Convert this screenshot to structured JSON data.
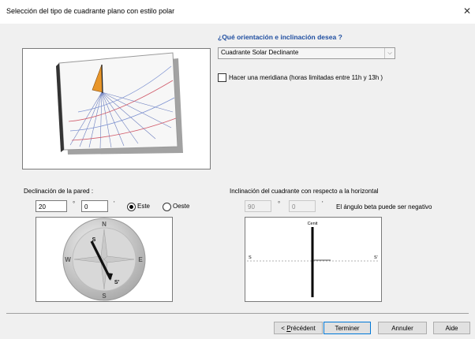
{
  "window": {
    "title": "Selección del tipo de cuadrante plano con estilo polar",
    "close_glyph": "✕"
  },
  "orientation": {
    "question": "¿Qué orientación e inclinación desea ?",
    "selected_option": "Cuadrante Solar Declinante",
    "meridian_label": "Hacer una meridiana (horas limitadas entre 11h y 13h )",
    "meridian_checked": false
  },
  "declination": {
    "label": "Declinación de la pared :",
    "degrees": "20",
    "minutes": "0",
    "deg_symbol": "°",
    "min_symbol": "'",
    "east_label": "Este",
    "west_label": "Oeste",
    "selected": "east",
    "compass": {
      "north": "N",
      "south": "S",
      "east": "E",
      "west": "W",
      "needle_s": "S",
      "needle_s_prime": "S'"
    }
  },
  "inclination": {
    "label": "Inclinación del cuadrante con respecto a la horizontal",
    "degrees": "90",
    "minutes": "0",
    "deg_symbol": "°",
    "min_symbol": "'",
    "beta_note": "El ángulo beta puede ser negativo",
    "diagram": {
      "top_label": "Cenit",
      "left_label": "S",
      "right_label": "S'"
    }
  },
  "buttons": {
    "back_prefix": "< ",
    "back_mnemonic": "P",
    "back_rest": "récédent",
    "finish": "Terminer",
    "cancel": "Annuler",
    "help": "Aide"
  },
  "colors": {
    "heading": "#1f4ea0",
    "gnomon": "#e8962a",
    "accent_button": "#0078d7"
  }
}
